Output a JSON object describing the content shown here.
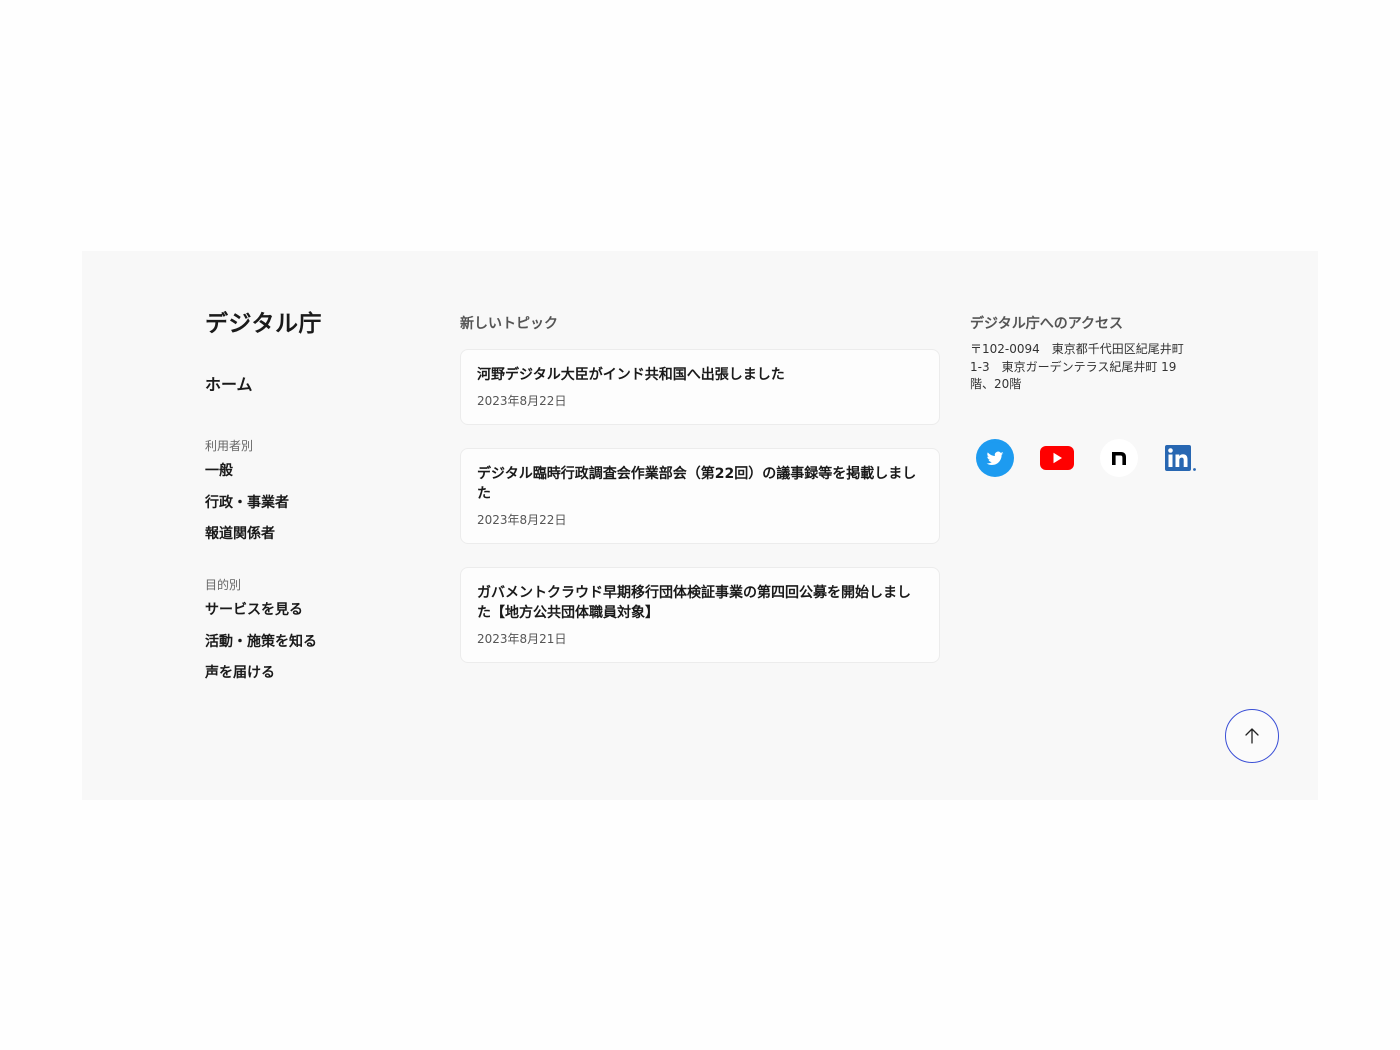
{
  "brand": {
    "logo_text": "デジタル庁"
  },
  "nav": {
    "home_label": "ホーム",
    "groups": [
      {
        "heading": "利用者別",
        "items": [
          "一般",
          "行政・事業者",
          "報道関係者"
        ]
      },
      {
        "heading": "目的別",
        "items": [
          "サービスを見る",
          "活動・施策を知る",
          "声を届ける"
        ]
      }
    ]
  },
  "topics": {
    "heading": "新しいトピック",
    "items": [
      {
        "title": "河野デジタル大臣がインド共和国へ出張しました",
        "date": "2023年8月22日"
      },
      {
        "title": "デジタル臨時行政調査会作業部会（第22回）の議事録等を掲載しました",
        "date": "2023年8月22日"
      },
      {
        "title": "ガバメントクラウド早期移行団体検証事業の第四回公募を開始しました【地方公共団体職員対象】",
        "date": "2023年8月21日"
      }
    ]
  },
  "access": {
    "heading": "デジタル庁へのアクセス",
    "address_line1": "〒102-0094　東京都千代田区紀尾井町",
    "address_line2": "1-3　東京ガーデンテラス紀尾井町 19",
    "address_line3": "階、20階"
  },
  "social": [
    {
      "icon": "twitter-icon",
      "color": "#1d9bf0"
    },
    {
      "icon": "youtube-icon",
      "color": "#ff0000"
    },
    {
      "icon": "note-icon",
      "color": "#000000"
    },
    {
      "icon": "linkedin-icon",
      "color": "#2867b2"
    }
  ],
  "back_to_top": {
    "icon": "arrow-up-icon",
    "color": "#3a4fd6"
  }
}
